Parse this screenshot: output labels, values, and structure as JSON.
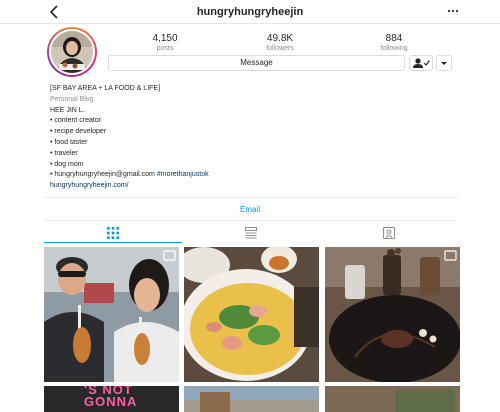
{
  "header": {
    "username": "hungryhungryheejin",
    "back_icon": "chevron-left-icon",
    "more_icon": "ellipsis-icon"
  },
  "stats": {
    "posts_value": "4,150",
    "posts_label": "posts",
    "followers_value": "49.8K",
    "followers_label": "followers",
    "following_value": "884",
    "following_label": "following"
  },
  "actions": {
    "message_label": "Message",
    "follow_icon": "person-check-icon",
    "dropdown_icon": "caret-down-icon"
  },
  "bio": {
    "headline": "[SF BAY AREA + LA FOOD & LIFE]",
    "category": "Personal Blog",
    "name": "HEE JIN L.",
    "lines": [
      "• content creator",
      "• recipe developer",
      "• food taster",
      "• traveler",
      "• dog mom"
    ],
    "contact_text": "• hungryhungryheejin@gmail.com",
    "hashtag": "#morethanjustok",
    "website": "hungryhungryheejin.com/"
  },
  "email_label": "Email",
  "tabs": [
    {
      "icon": "grid-icon",
      "active": true
    },
    {
      "icon": "list-icon",
      "active": false
    },
    {
      "icon": "tagged-icon",
      "active": false
    }
  ],
  "posts": [
    {
      "kind": "photo",
      "description": "two people holding corn dogs",
      "multi_icon": "carousel-icon",
      "sign_text": "'S NOT\nGONNA"
    },
    {
      "kind": "photo",
      "description": "banh xeo crepe with herbs"
    },
    {
      "kind": "photo",
      "description": "chocolate dessert with drinks",
      "multi_icon": "carousel-icon"
    }
  ],
  "colors": {
    "accent": "#0095f6",
    "text": "#262626",
    "muted": "#8e8e8e",
    "link": "#00376b",
    "neon_pink": "#ff5fa8"
  }
}
